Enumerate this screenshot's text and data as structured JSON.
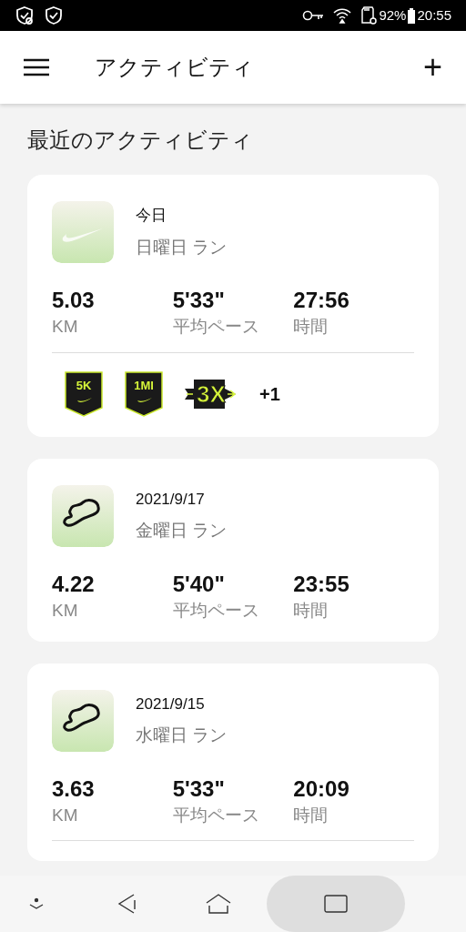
{
  "status_bar": {
    "battery": "92%",
    "time": "20:55"
  },
  "app_bar": {
    "title": "アクティビティ",
    "add": "+"
  },
  "section_title": "最近のアクティビティ",
  "activities": [
    {
      "kind": "swoosh",
      "date": "今日",
      "name": "日曜日 ラン",
      "stats": [
        {
          "value": "5.03",
          "label": "KM"
        },
        {
          "value": "5'33\"",
          "label": "平均ペース"
        },
        {
          "value": "27:56",
          "label": "時間"
        }
      ],
      "badges": [
        {
          "kind": "shield",
          "label": "5K"
        },
        {
          "kind": "shield",
          "label": "1MI"
        },
        {
          "kind": "arrow",
          "label": "3X"
        }
      ],
      "more": "+1"
    },
    {
      "kind": "route",
      "date": "2021/9/17",
      "name": "金曜日 ラン",
      "stats": [
        {
          "value": "4.22",
          "label": "KM"
        },
        {
          "value": "5'40\"",
          "label": "平均ペース"
        },
        {
          "value": "23:55",
          "label": "時間"
        }
      ]
    },
    {
      "kind": "route",
      "date": "2021/9/15",
      "name": "水曜日 ラン",
      "stats": [
        {
          "value": "3.63",
          "label": "KM"
        },
        {
          "value": "5'33\"",
          "label": "平均ペース"
        },
        {
          "value": "20:09",
          "label": "時間"
        }
      ],
      "divider": true
    }
  ]
}
